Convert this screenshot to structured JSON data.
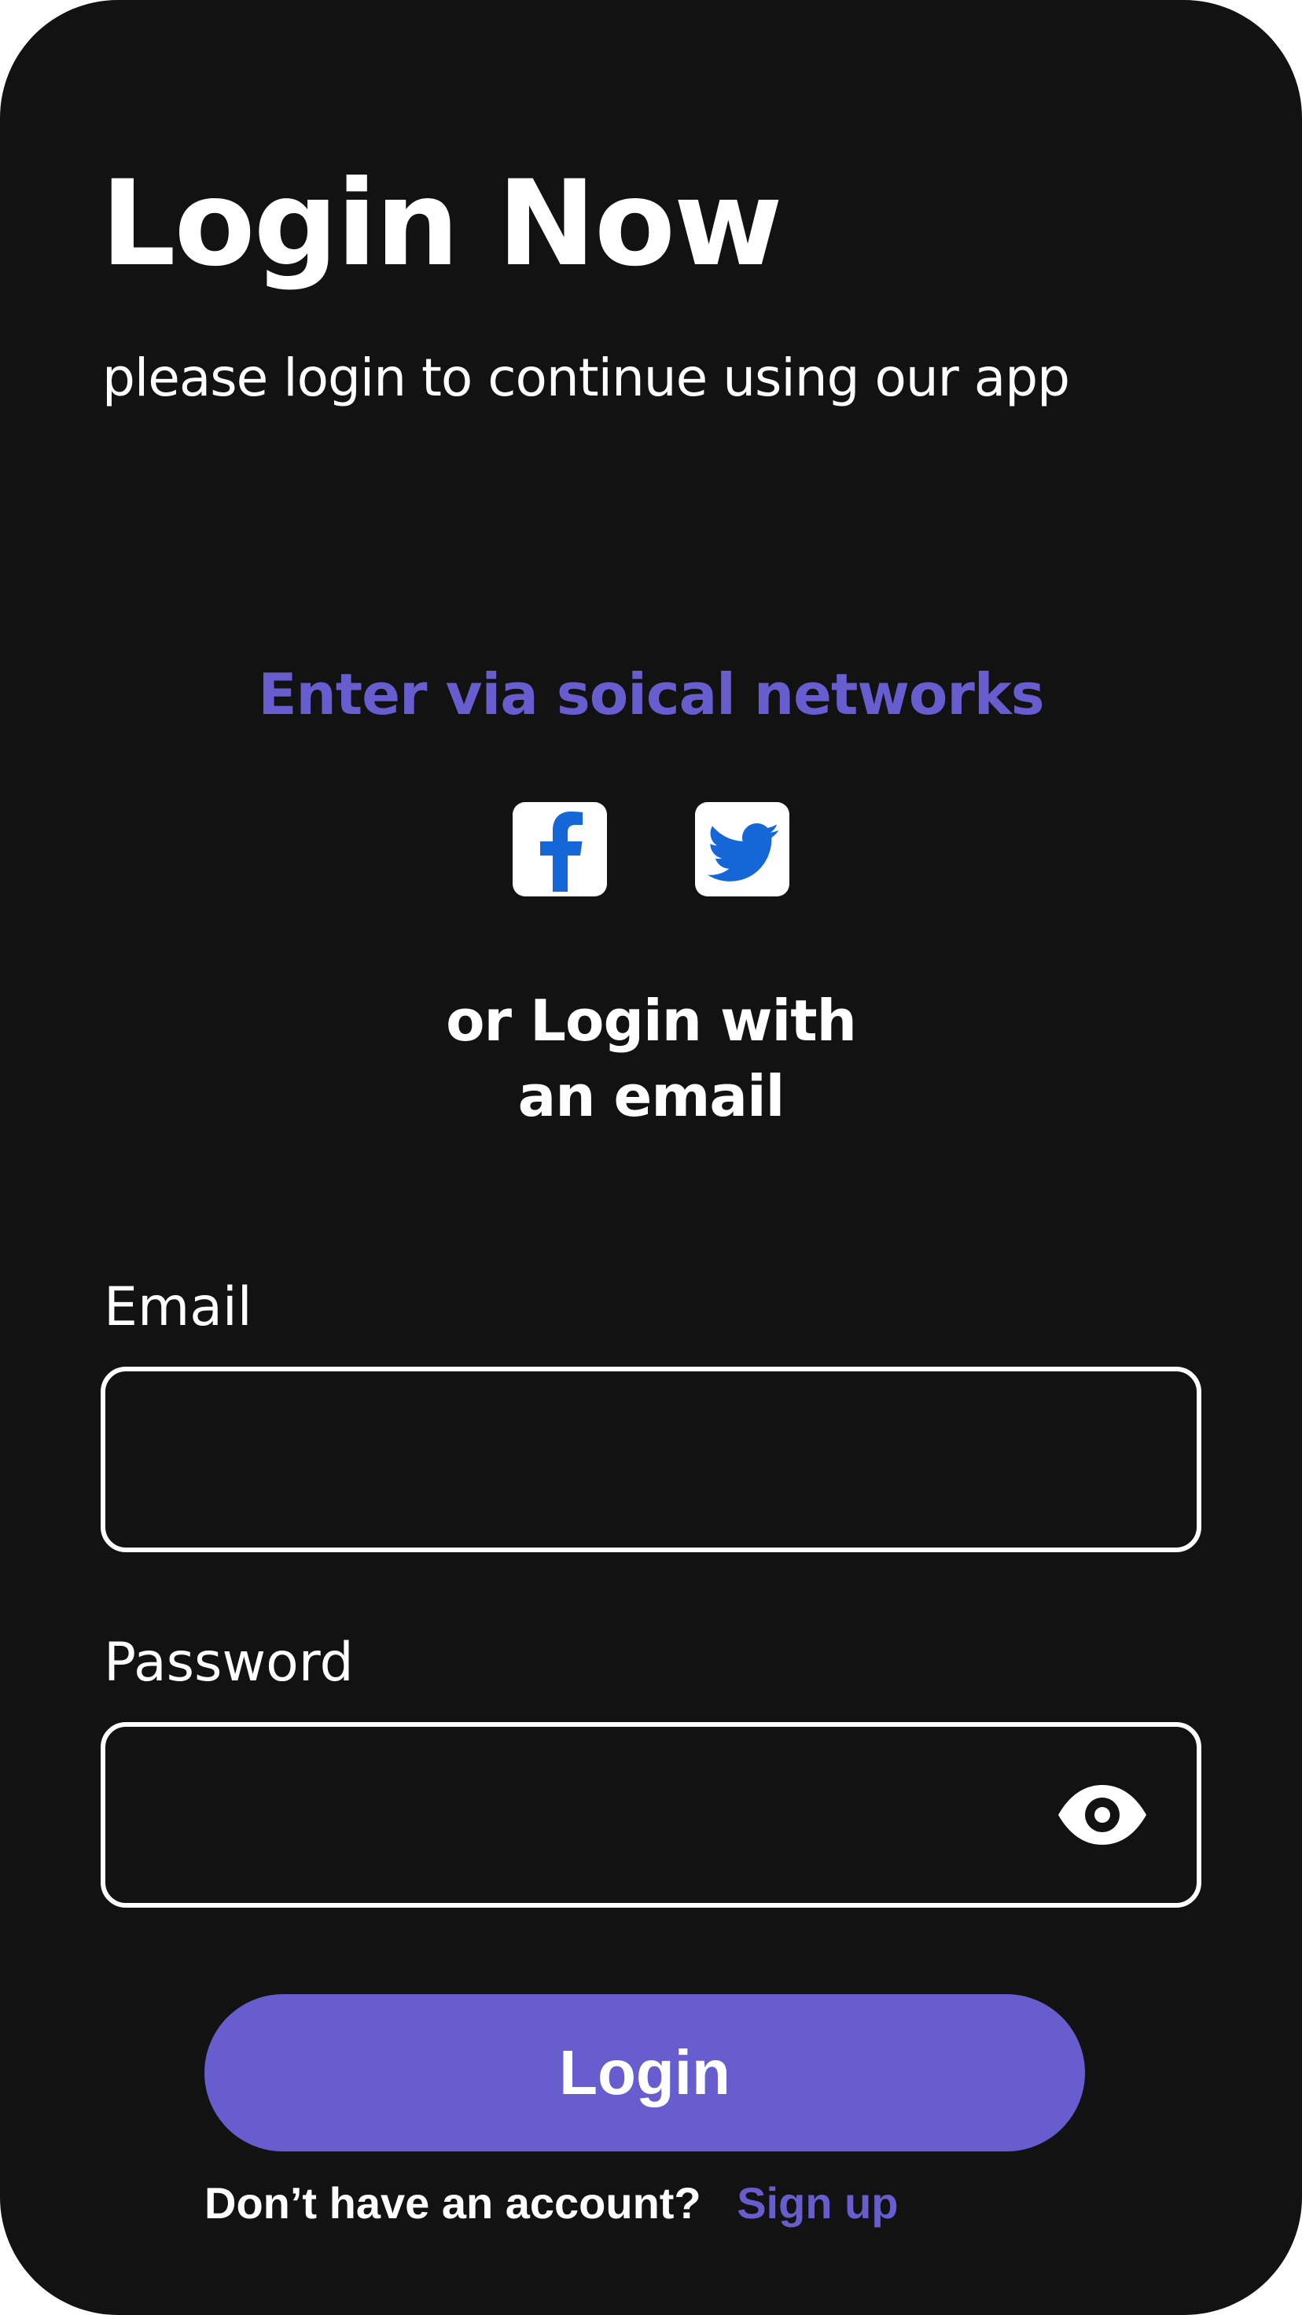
{
  "colors": {
    "background": "#121212",
    "accent": "#675dcf",
    "text": "#ffffff",
    "social_icon": "#1566d6"
  },
  "header": {
    "title": "Login Now",
    "subtitle": "please login to continue using our app"
  },
  "social": {
    "heading": "Enter via soical networks",
    "buttons": [
      {
        "icon": "facebook-icon"
      },
      {
        "icon": "twitter-icon"
      }
    ]
  },
  "divider": {
    "line1": "or Login with",
    "line2": "an email"
  },
  "form": {
    "email": {
      "label": "Email",
      "value": "",
      "placeholder": ""
    },
    "password": {
      "label": "Password",
      "value": "",
      "placeholder": "",
      "toggle_icon": "eye-icon"
    },
    "login_label": "Login"
  },
  "footer": {
    "question": "Don’t have an account?",
    "signup_label": "Sign up"
  }
}
